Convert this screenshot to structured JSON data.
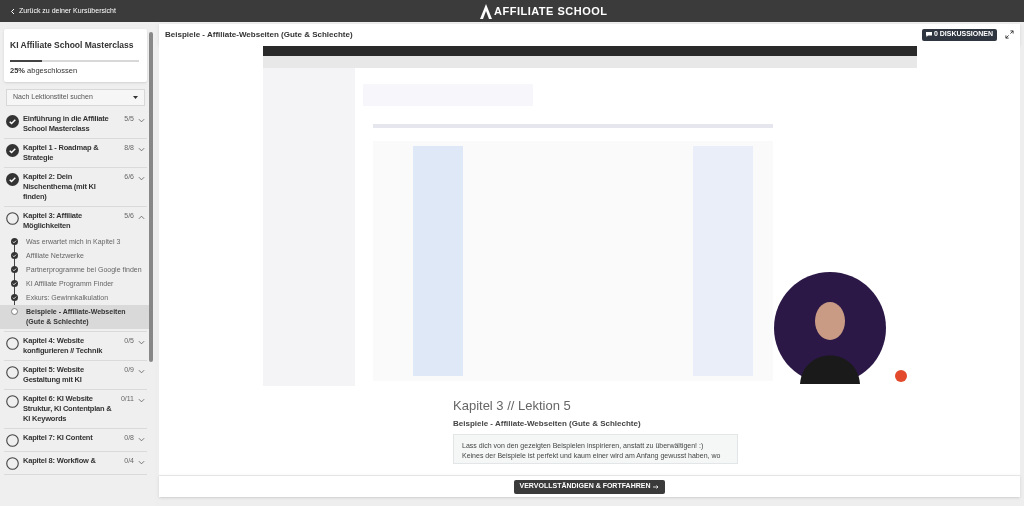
{
  "topbar": {
    "back_link": "Zurück zu deiner Kursübersicht",
    "logo": "AFFILIATE SCHOOL"
  },
  "sidebar": {
    "course_title": "KI Affiliate School Masterclass",
    "progress": {
      "level": 0.25,
      "label": "**25%** abgeschlossen"
    },
    "search": {
      "placeholder": "Nach Lektionstitel suchen"
    },
    "chapters": [
      {
        "title": "Einführung in die Affiliate School Masterclass",
        "count": "5/5",
        "done": true,
        "expanded": false
      },
      {
        "title": "Kapitel 1 - Roadmap & Strategie",
        "count": "8/8",
        "done": true,
        "expanded": false
      },
      {
        "title": "Kapitel 2: Dein Nischenthema (mit KI finden)",
        "count": "6/6",
        "done": true,
        "expanded": false
      },
      {
        "title": "Kapitel 3: Affiliate Möglichkeiten",
        "count": "5/6",
        "done": false,
        "expanded": true,
        "lessons": [
          {
            "title": "Was erwartet mich in Kapitel 3",
            "done": true,
            "selected": false
          },
          {
            "title": "Affiliate Netzwerke",
            "done": true,
            "selected": false
          },
          {
            "title": "Partnerprogramme bei Google finden",
            "done": true,
            "selected": false
          },
          {
            "title": "KI Affiliate Programm Finder",
            "done": true,
            "selected": false
          },
          {
            "title": "Exkurs: Gewinnkalkulation",
            "done": true,
            "selected": false
          },
          {
            "title": "Beispiele - Affiliate-Webseiten (Gute & Schlechte)",
            "done": false,
            "selected": true
          }
        ]
      },
      {
        "title": "Kapitel 4: Website konfigurieren // Technik",
        "count": "0/5",
        "done": false,
        "expanded": false
      },
      {
        "title": "Kapitel 5: Website Gestaltung mit KI",
        "count": "0/9",
        "done": false,
        "expanded": false
      },
      {
        "title": "Kapitel 6: KI Website Struktur, KI Contentplan & KI Keywords",
        "count": "0/11",
        "done": false,
        "expanded": false
      },
      {
        "title": "Kapitel 7: KI Content",
        "count": "0/8",
        "done": false,
        "expanded": false
      },
      {
        "title": "Kapitel 8: Workflow &",
        "count": "0/4",
        "done": false,
        "expanded": false
      }
    ]
  },
  "main": {
    "lesson_title": "Beispiele - Affiliate-Webseiten (Gute & Schlechte)",
    "discussions": "0 DISKUSSIONEN",
    "heading": "Kapitel 3 // Lektion 5",
    "subheading": "Beispiele - Affiliate-Webseiten (Gute & Schlechte)",
    "note_lines": [
      "Lass dich von den gezeigten Beispielen inspirieren, anstatt zu überwältigen! :)",
      "Keines der Beispiele ist perfekt und kaum einer wird am Anfang gewusst haben, wo"
    ],
    "complete_button": "VERVOLLSTÄNDIGEN & FORTFAHREN"
  }
}
